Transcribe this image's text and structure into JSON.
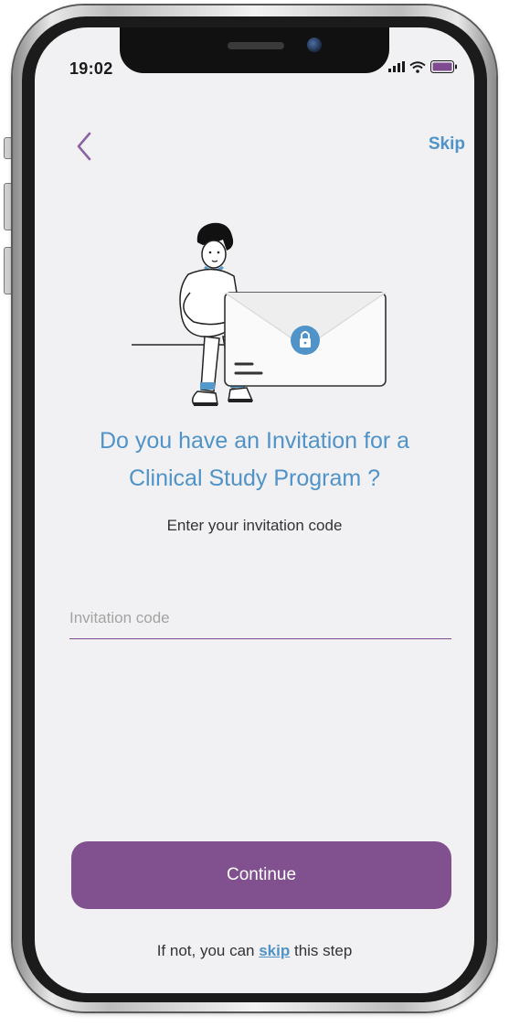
{
  "status_bar": {
    "time": "19:02"
  },
  "header": {
    "back_icon": "chevron-left-icon",
    "skip_label": "Skip"
  },
  "main": {
    "illustration_icon": "person-envelope-lock-illustration",
    "title_line1": "Do you have an Invitation for a",
    "title_line2": "Clinical Study Program ?",
    "subtitle": "Enter your invitation code",
    "input": {
      "value": "",
      "placeholder": "Invitation code"
    }
  },
  "actions": {
    "continue_label": "Continue"
  },
  "footer": {
    "prefix": "If not, you can ",
    "link": "skip",
    "suffix": " this step"
  },
  "colors": {
    "accent_blue": "#4f93c8",
    "primary_purple": "#81508f",
    "screen_background": "#f1f1f3"
  }
}
